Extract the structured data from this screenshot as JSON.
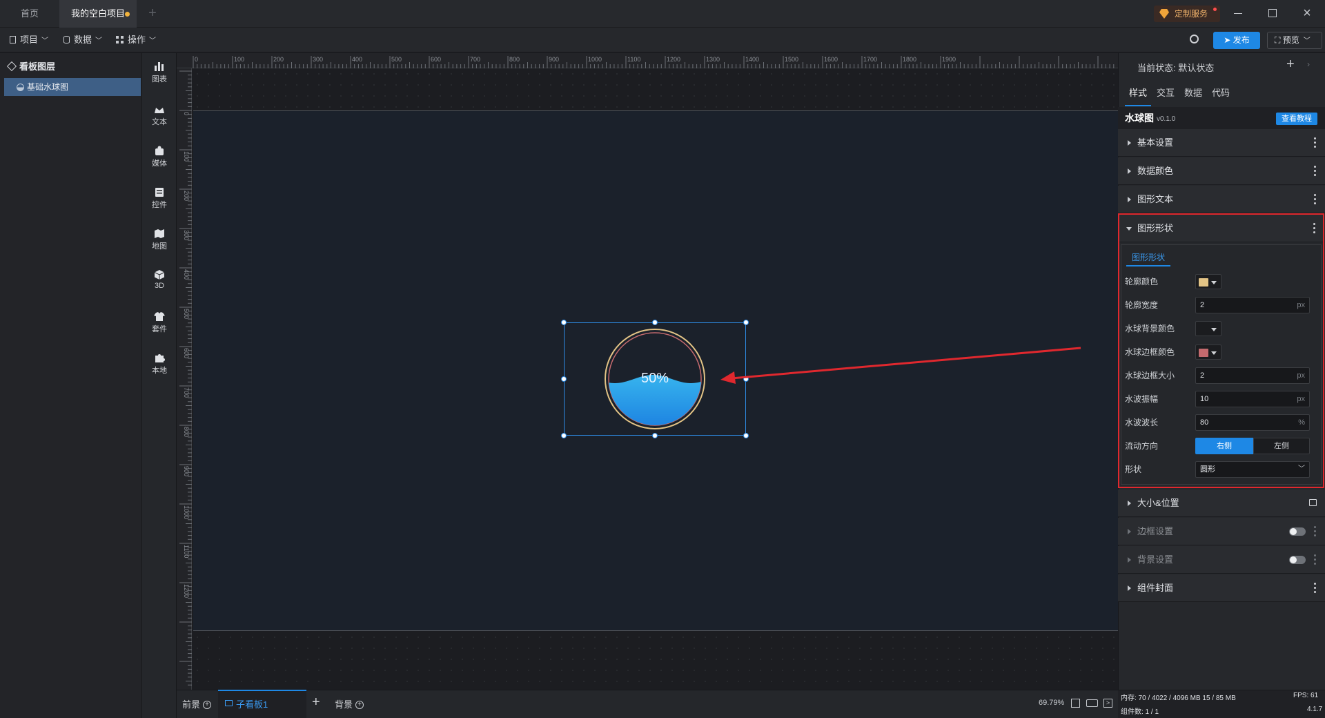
{
  "titlebar": {
    "tabs": [
      {
        "label": "首页"
      },
      {
        "label": "我的空白项目"
      }
    ],
    "custom_service": "定制服务"
  },
  "menubar": {
    "items": [
      {
        "label": "项目"
      },
      {
        "label": "数据"
      },
      {
        "label": "操作"
      }
    ],
    "publish": "发布",
    "preview": "预览"
  },
  "layers": {
    "title": "看板图层",
    "items": [
      {
        "label": "基础水球图"
      }
    ]
  },
  "toolbox": {
    "items": [
      {
        "label": "图表",
        "icon": "chart-icon"
      },
      {
        "label": "文本",
        "icon": "text-icon"
      },
      {
        "label": "媒体",
        "icon": "media-icon"
      },
      {
        "label": "控件",
        "icon": "control-icon"
      },
      {
        "label": "地图",
        "icon": "map-icon"
      },
      {
        "label": "3D",
        "icon": "cube-icon"
      },
      {
        "label": "套件",
        "icon": "kit-icon"
      },
      {
        "label": "本地",
        "icon": "puzzle-icon"
      }
    ]
  },
  "ruler": {
    "top": [
      "0",
      "100",
      "200",
      "300",
      "400",
      "500",
      "600",
      "700",
      "800",
      "900",
      "1000",
      "1100",
      "1200",
      "1300",
      "1400",
      "1500",
      "1600",
      "1700",
      "1800",
      "1900"
    ],
    "left": [
      "0",
      "100",
      "200",
      "300",
      "400",
      "500",
      "600",
      "700",
      "800",
      "900",
      "1000",
      "1100",
      "1200"
    ]
  },
  "canvas": {
    "liquid_fill": {
      "value": 0.5,
      "label": "50%"
    }
  },
  "bottombar": {
    "foreground": "前景",
    "subboard": "子看板1",
    "background": "背景",
    "zoom": "69.79%"
  },
  "right": {
    "state_label": "当前状态:",
    "state_value": "默认状态",
    "tabs": [
      {
        "label": "样式"
      },
      {
        "label": "交互"
      },
      {
        "label": "数据"
      },
      {
        "label": "代码"
      }
    ],
    "component_name": "水球图",
    "version": "v0.1.0",
    "tutorial": "查看教程",
    "sections_top": [
      {
        "label": "基本设置"
      },
      {
        "label": "数据颜色"
      },
      {
        "label": "图形文本"
      }
    ],
    "shape_section": {
      "title": "图形形状",
      "subtab": "图形形状",
      "rows": {
        "outline_color": {
          "label": "轮廓颜色",
          "color": "#e3c486"
        },
        "outline_width": {
          "label": "轮廓宽度",
          "value": "2",
          "unit": "px"
        },
        "ball_bg_color": {
          "label": "水球背景颜色"
        },
        "ball_border_color": {
          "label": "水球边框颜色",
          "color": "#c46a6e"
        },
        "ball_border_size": {
          "label": "水球边框大小",
          "value": "2",
          "unit": "px"
        },
        "wave_amplitude": {
          "label": "水波振幅",
          "value": "10",
          "unit": "px"
        },
        "wave_length": {
          "label": "水波波长",
          "value": "80",
          "unit": "%"
        },
        "flow_direction": {
          "label": "流动方向",
          "option_right": "右侧",
          "option_left": "左侧"
        },
        "shape": {
          "label": "形状",
          "value": "圆形"
        }
      }
    },
    "sections_bottom": [
      {
        "label": "大小&位置"
      },
      {
        "label": "边框设置"
      },
      {
        "label": "背景设置"
      },
      {
        "label": "组件封面"
      }
    ]
  },
  "status": {
    "memory": "内存: 70 / 4022 / 4096 MB 15 / 85 MB",
    "fps": "FPS: 61",
    "components": "组件数: 1 / 1",
    "version": "4.1.7"
  },
  "colors": {
    "accent": "#1e88e5",
    "highlight_border": "#e0282e",
    "wave": "#2ea8e8"
  }
}
